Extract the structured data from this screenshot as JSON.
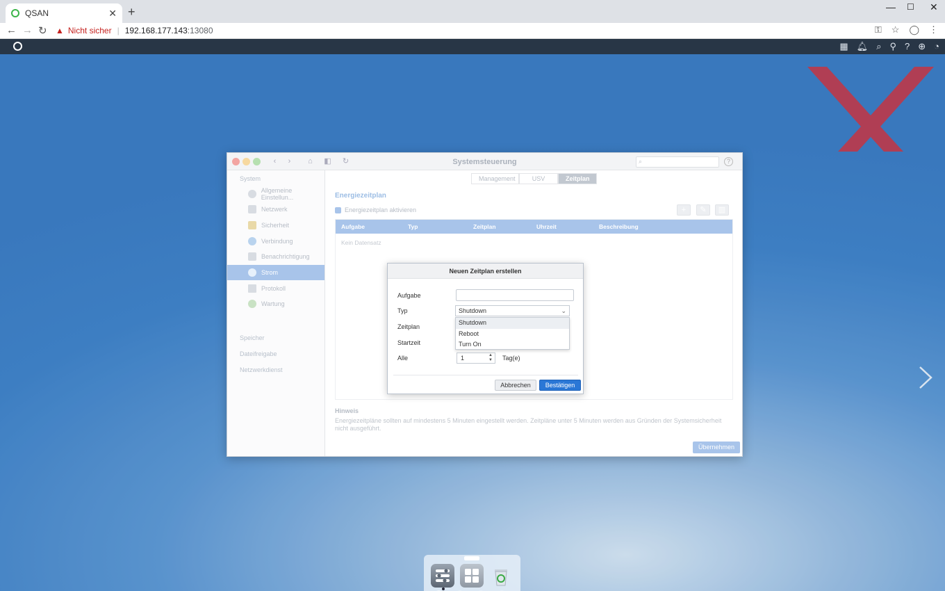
{
  "browser": {
    "tab_title": "QSAN",
    "security_label": "Nicht sicher",
    "url_host": "192.168.177.143",
    "url_port": ":13080"
  },
  "window": {
    "title": "Systemsteuerung",
    "tabs": [
      {
        "label": "Management"
      },
      {
        "label": "USV"
      },
      {
        "label": "Zeitplan"
      }
    ],
    "sidebar": {
      "system_label": "System",
      "items": [
        {
          "label": "Allgemeine Einstellun..."
        },
        {
          "label": "Netzwerk"
        },
        {
          "label": "Sicherheit"
        },
        {
          "label": "Verbindung"
        },
        {
          "label": "Benachrichtigung"
        },
        {
          "label": "Strom"
        },
        {
          "label": "Protokoll"
        },
        {
          "label": "Wartung"
        }
      ],
      "sections": [
        {
          "label": "Speicher"
        },
        {
          "label": "Dateifreigabe"
        },
        {
          "label": "Netzwerkdienst"
        }
      ]
    },
    "content_title": "Energiezeitplan",
    "enable_label": "Energiezeitplan aktivieren",
    "table": {
      "columns": [
        "Aufgabe",
        "Typ",
        "Zeitplan",
        "Uhrzeit",
        "Beschreibung"
      ],
      "empty_text": "Kein Datensatz"
    },
    "hint_title": "Hinweis",
    "hint_text": "Energiezeitpläne sollten auf mindestens 5 Minuten eingestellt werden. Zeitpläne unter 5 Minuten werden aus Gründen der Systemsicherheit nicht ausgeführt.",
    "apply_label": "Übernehmen"
  },
  "dialog": {
    "title": "Neuen Zeitplan erstellen",
    "labels": {
      "task": "Aufgabe",
      "type": "Typ",
      "schedule": "Zeitplan",
      "start": "Startzeit",
      "every": "Alle"
    },
    "task_value": "",
    "type_selected": "Shutdown",
    "type_options": [
      "Shutdown",
      "Reboot",
      "Turn On"
    ],
    "every_value": "1",
    "every_unit": "Tag(e)",
    "cancel_label": "Abbrechen",
    "confirm_label": "Bestätigen"
  },
  "colors": {
    "accent": "#2a77d6",
    "sidebar_active": "#a8c4ea",
    "watermark": "#d5313b"
  }
}
